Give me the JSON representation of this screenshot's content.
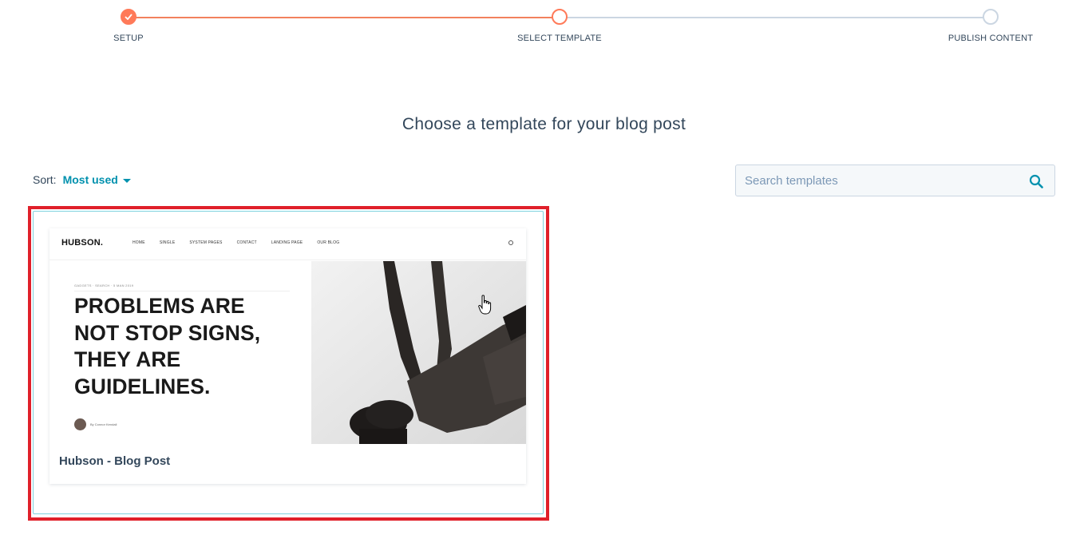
{
  "stepper": {
    "steps": [
      {
        "label": "SETUP",
        "state": "done"
      },
      {
        "label": "SELECT TEMPLATE",
        "state": "current"
      },
      {
        "label": "PUBLISH CONTENT",
        "state": "todo"
      }
    ],
    "accent_color": "#ff7a59",
    "inactive_color": "#cbd6e2"
  },
  "page": {
    "title": "Choose a template for your blog post"
  },
  "sort": {
    "label": "Sort:",
    "value": "Most used",
    "icon": "caret-down-icon"
  },
  "search": {
    "placeholder": "Search templates",
    "value": "",
    "icon": "search-icon"
  },
  "templates": [
    {
      "name": "Hubson - Blog Post",
      "preview": {
        "logo": "HUBSON.",
        "menu": [
          "HOME",
          "SINGLE",
          "SYSTEM PAGES",
          "CONTACT",
          "LANDING PAGE",
          "OUR BLOG"
        ],
        "meta": "GADGETS  ·  SEARCH  ·  5 MAN 2019",
        "headline_lines": [
          "PROBLEMS ARE",
          "NOT STOP SIGNS,",
          "THEY ARE",
          "GUIDELINES."
        ],
        "author": "By Connor Kendall"
      },
      "highlight_color": "#e0202a"
    }
  ]
}
